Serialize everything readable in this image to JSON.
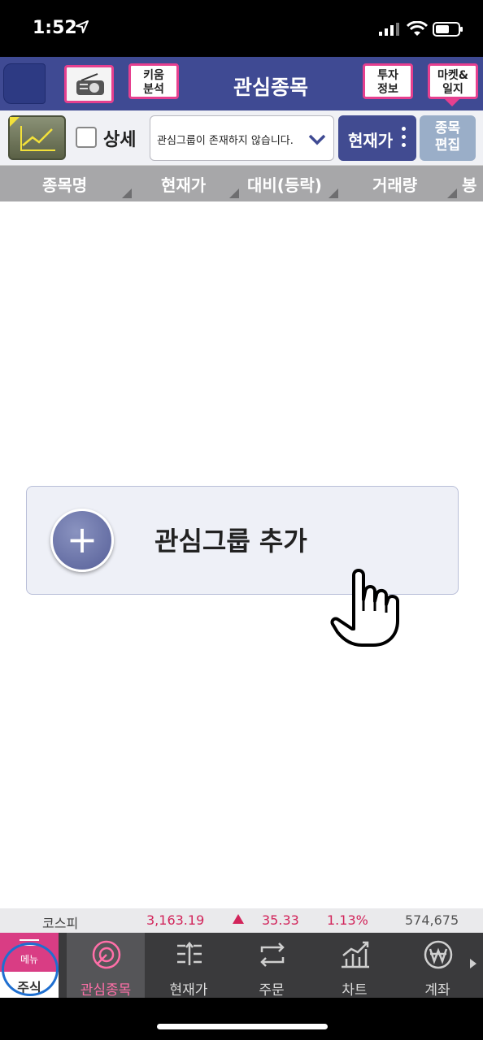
{
  "status": {
    "time": "1:52"
  },
  "header": {
    "title": "관심종목",
    "kiwoom_label_1": "키움",
    "kiwoom_label_2": "분석",
    "invest_label_1": "투자",
    "invest_label_2": "정보",
    "market_label_1": "마켓&",
    "market_label_2": "일지"
  },
  "toolbar": {
    "detail_label": "상세",
    "group_select_text": "관심그룹이 존재하지 않습니다.",
    "price_label": "현재가",
    "edit_label_1": "종목",
    "edit_label_2": "편집"
  },
  "columns": [
    "종목명",
    "현재가",
    "대비(등락)",
    "거래량",
    "봉"
  ],
  "main": {
    "add_group_label": "관심그룹 추가",
    "add_icon": "+"
  },
  "ticker": {
    "index_name": "코스피",
    "value": "3,163.19",
    "change": "35.33",
    "percent": "1.13%",
    "volume": "574,675",
    "up_color": "#d2245a"
  },
  "bottom_nav": {
    "menu_small": "메뉴",
    "menu_stock": "주식",
    "items": [
      {
        "label": "관심종목",
        "icon": "watchlist-icon"
      },
      {
        "label": "현재가",
        "icon": "current-price-icon"
      },
      {
        "label": "주문",
        "icon": "order-icon"
      },
      {
        "label": "차트",
        "icon": "chart-icon"
      },
      {
        "label": "계좌",
        "icon": "won-account-icon"
      }
    ]
  }
}
